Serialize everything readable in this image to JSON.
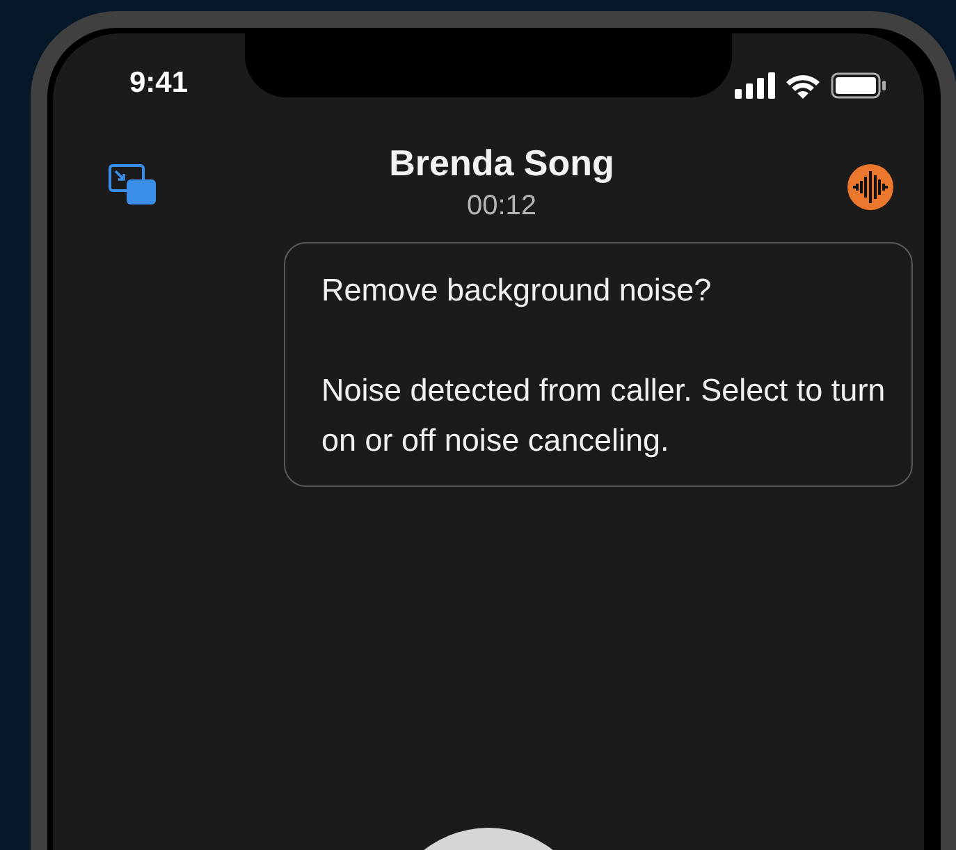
{
  "status_bar": {
    "time": "9:41"
  },
  "call": {
    "caller": "Brenda Song",
    "duration": "00:12"
  },
  "tooltip": {
    "title": "Remove background noise?",
    "body": "Noise detected from caller. Select to turn on or off noise canceling."
  }
}
